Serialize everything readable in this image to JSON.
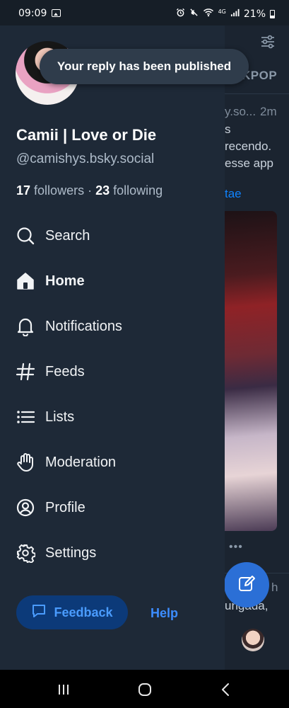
{
  "status_bar": {
    "time": "09:09",
    "network": "4G",
    "battery": "21%"
  },
  "background": {
    "tab_label": "KPOP",
    "post_handle": "y.so...",
    "post_time": "2m",
    "post_lines": [
      "s",
      "recendo.",
      "esse app"
    ],
    "post_link": "tae",
    "reply_time": "h",
    "reply_text": "ungada,"
  },
  "toast": {
    "message": "Your reply has been published"
  },
  "profile": {
    "display_name": "Camii | Love or Die",
    "handle": "@camishys.bsky.social",
    "followers_count": "17",
    "followers_label": "followers",
    "separator": "·",
    "following_count": "23",
    "following_label": "following"
  },
  "nav": {
    "items": [
      {
        "label": "Search",
        "icon": "search-icon"
      },
      {
        "label": "Home",
        "icon": "home-icon",
        "active": true
      },
      {
        "label": "Notifications",
        "icon": "bell-icon"
      },
      {
        "label": "Feeds",
        "icon": "hash-icon"
      },
      {
        "label": "Lists",
        "icon": "list-icon"
      },
      {
        "label": "Moderation",
        "icon": "hand-icon"
      },
      {
        "label": "Profile",
        "icon": "user-circle-icon"
      },
      {
        "label": "Settings",
        "icon": "gear-icon"
      }
    ]
  },
  "footer": {
    "feedback_label": "Feedback",
    "help_label": "Help"
  },
  "colors": {
    "drawer_bg": "#1e2937",
    "accent": "#1083fe",
    "feedback_bg": "#0c3a79",
    "fab": "#2b6fd6"
  }
}
